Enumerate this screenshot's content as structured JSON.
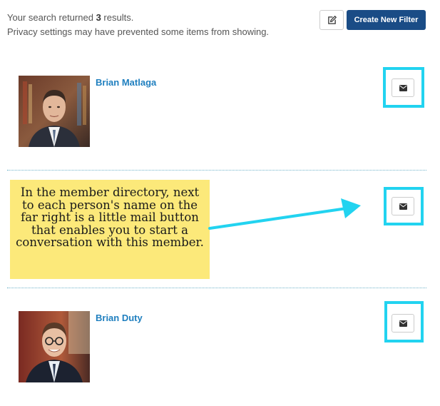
{
  "search": {
    "results_prefix": "Your search returned",
    "results_count": "3",
    "results_suffix": "results.",
    "privacy_note": "Privacy settings may have prevented some items from showing."
  },
  "toolbar": {
    "edit_icon": "edit-icon",
    "create_filter_label": "Create New Filter",
    "accent_color": "#1a4c86"
  },
  "members": [
    {
      "name": "Brian Matlaga",
      "mail_icon": "envelope-icon"
    },
    {
      "name": "Brian Duty",
      "mail_icon": "envelope-icon"
    }
  ],
  "hidden_row": {
    "mail_icon": "envelope-icon"
  },
  "annotation": {
    "text": "In the member directory, next to each person's name on the far right is a little mail button that enables you to start a conversation with this member.",
    "highlight_color": "#22d3f0",
    "callout_color": "#fce97a"
  }
}
